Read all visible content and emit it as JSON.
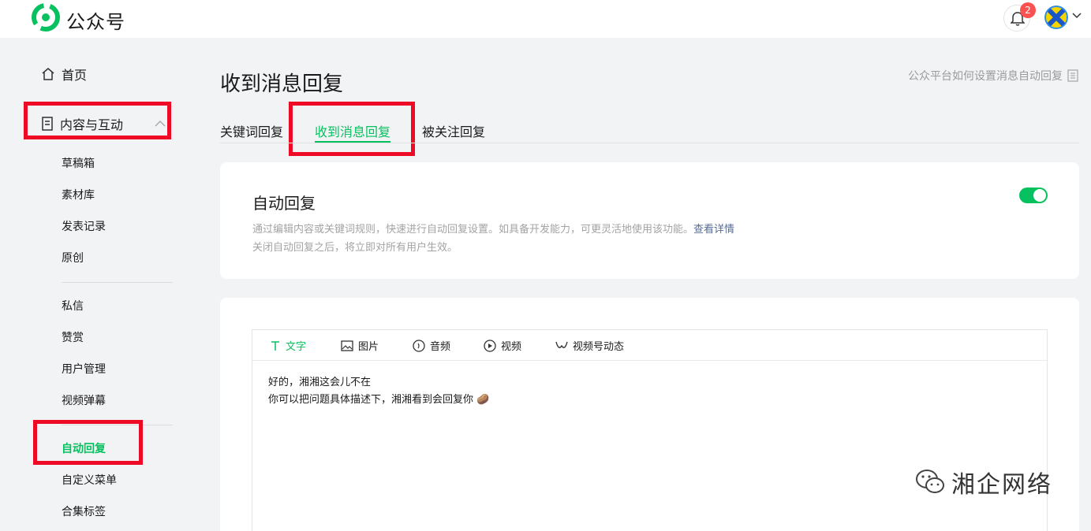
{
  "header": {
    "brand": "公众号",
    "notification_count": "2",
    "accent": "#07c160",
    "badge_color": "#fa5151"
  },
  "sidebar": {
    "home": "首页",
    "content_section": "内容与互动",
    "content_items": [
      "草稿箱",
      "素材库",
      "发表记录",
      "原创"
    ],
    "interaction_items": [
      "私信",
      "赞赏",
      "用户管理",
      "视频弹幕"
    ],
    "feature_items": [
      "自动回复",
      "自定义菜单",
      "合集标签"
    ],
    "active_item": "自动回复"
  },
  "main": {
    "title": "收到消息回复",
    "help_link": "公众平台如何设置消息自动回复",
    "tabs": [
      "关键词回复",
      "收到消息回复",
      "被关注回复"
    ],
    "active_tab": "收到消息回复",
    "auto_reply": {
      "title": "自动回复",
      "desc_line1": "通过编辑内容或关键词规则，快速进行自动回复设置。如具备开发能力，可更灵活地使用该功能。",
      "desc_link": "查看详情",
      "desc_line2": "关闭自动回复之后，将立即对所有用户生效。",
      "enabled": true
    },
    "editor": {
      "tabs": [
        "文字",
        "图片",
        "音频",
        "视频",
        "视频号动态"
      ],
      "active_tab": "文字",
      "line1": "好的，湘湘这会儿不在",
      "line2": "你可以把问题具体描述下，湘湘看到会回复你",
      "emoji": "🥔"
    }
  },
  "watermark": "湘企网络"
}
